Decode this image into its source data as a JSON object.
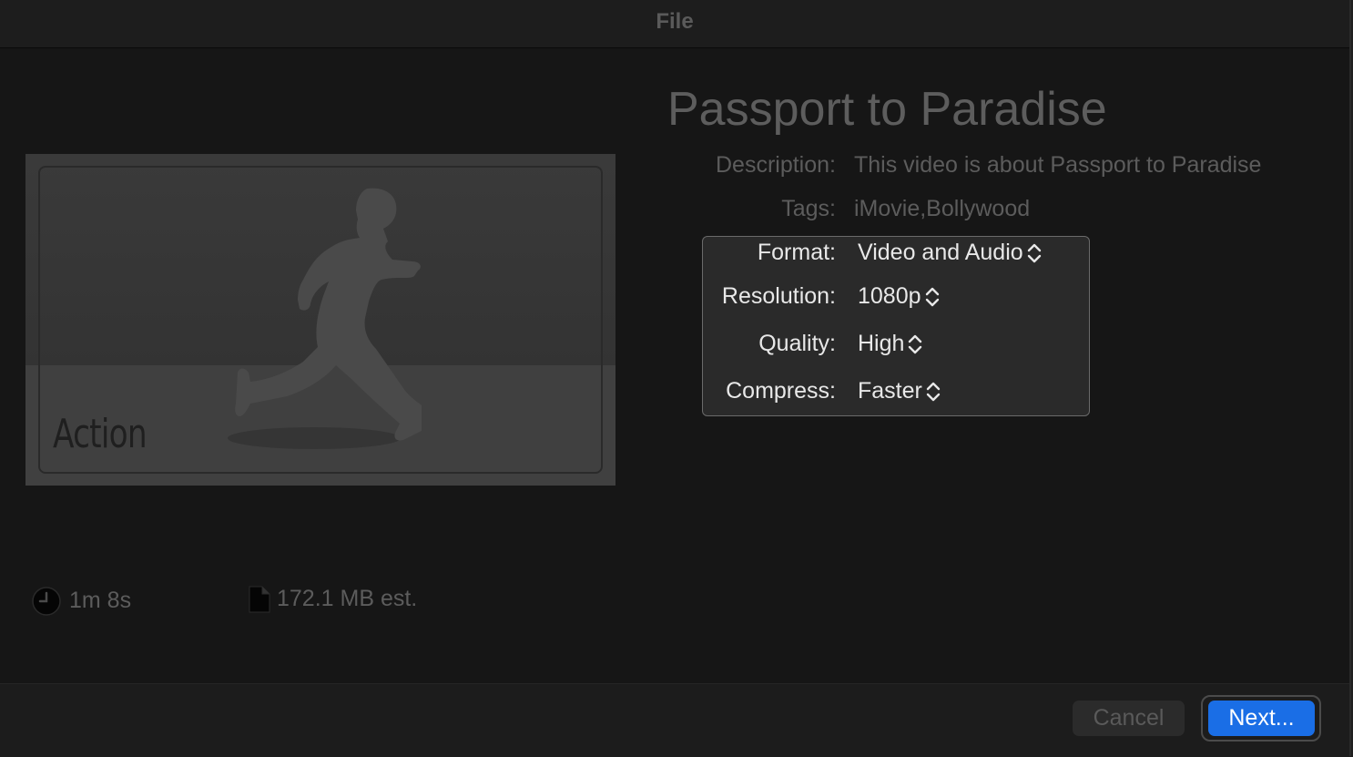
{
  "window": {
    "title": "File"
  },
  "thumbnail": {
    "theme_label": "Action"
  },
  "movie": {
    "title": "Passport to Paradise"
  },
  "details": {
    "description_label": "Description:",
    "description_value": "This video is about Passport to Paradise",
    "tags_label": "Tags:",
    "tags_value": "iMovie,Bollywood"
  },
  "settings": {
    "format_label": "Format:",
    "format_value": "Video and Audio",
    "resolution_label": "Resolution:",
    "resolution_value": "1080p",
    "quality_label": "Quality:",
    "quality_value": "High",
    "compress_label": "Compress:",
    "compress_value": "Faster"
  },
  "stats": {
    "duration": "1m 8s",
    "file_size": "172.1 MB est."
  },
  "buttons": {
    "cancel_label": "Cancel",
    "next_label": "Next..."
  },
  "icons": {
    "duration": "clock-icon",
    "file_size": "document-icon",
    "popup": "chevron-up-down-icon"
  },
  "colors": {
    "accent": "#1a6ee6",
    "background": "#161616",
    "dim_text": "#5c5c5c",
    "bright_text": "#e8e8e8"
  }
}
